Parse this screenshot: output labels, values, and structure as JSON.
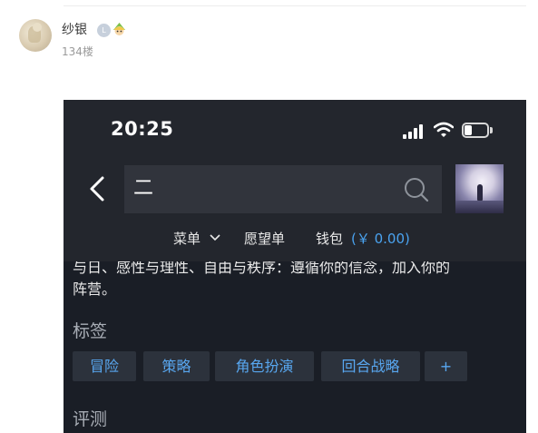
{
  "post": {
    "username": "纱银",
    "level_badge": "L",
    "floor": "134楼"
  },
  "phone": {
    "status_bar": {
      "time": "20:25",
      "battery_level": 0.35
    },
    "search": {
      "query": "二"
    },
    "menu": {
      "menu_label": "菜单",
      "wishlist_label": "愿望单",
      "wallet_label": "钱包",
      "wallet_amount": "(￥ 0.00)"
    },
    "description_line1": "与日、感性与理性、自由与秩序：遵循你的信念，加入你的",
    "description_line2": "阵营。",
    "tags_title": "标签",
    "tags": [
      "冒险",
      "策略",
      "角色扮演",
      "回合战略",
      "+"
    ],
    "reviews_title": "评测"
  },
  "colors": {
    "phone_bg": "#1a1e26",
    "header_bg": "#23262d",
    "accent": "#58a7f0",
    "tag_bg": "#2c323c"
  }
}
